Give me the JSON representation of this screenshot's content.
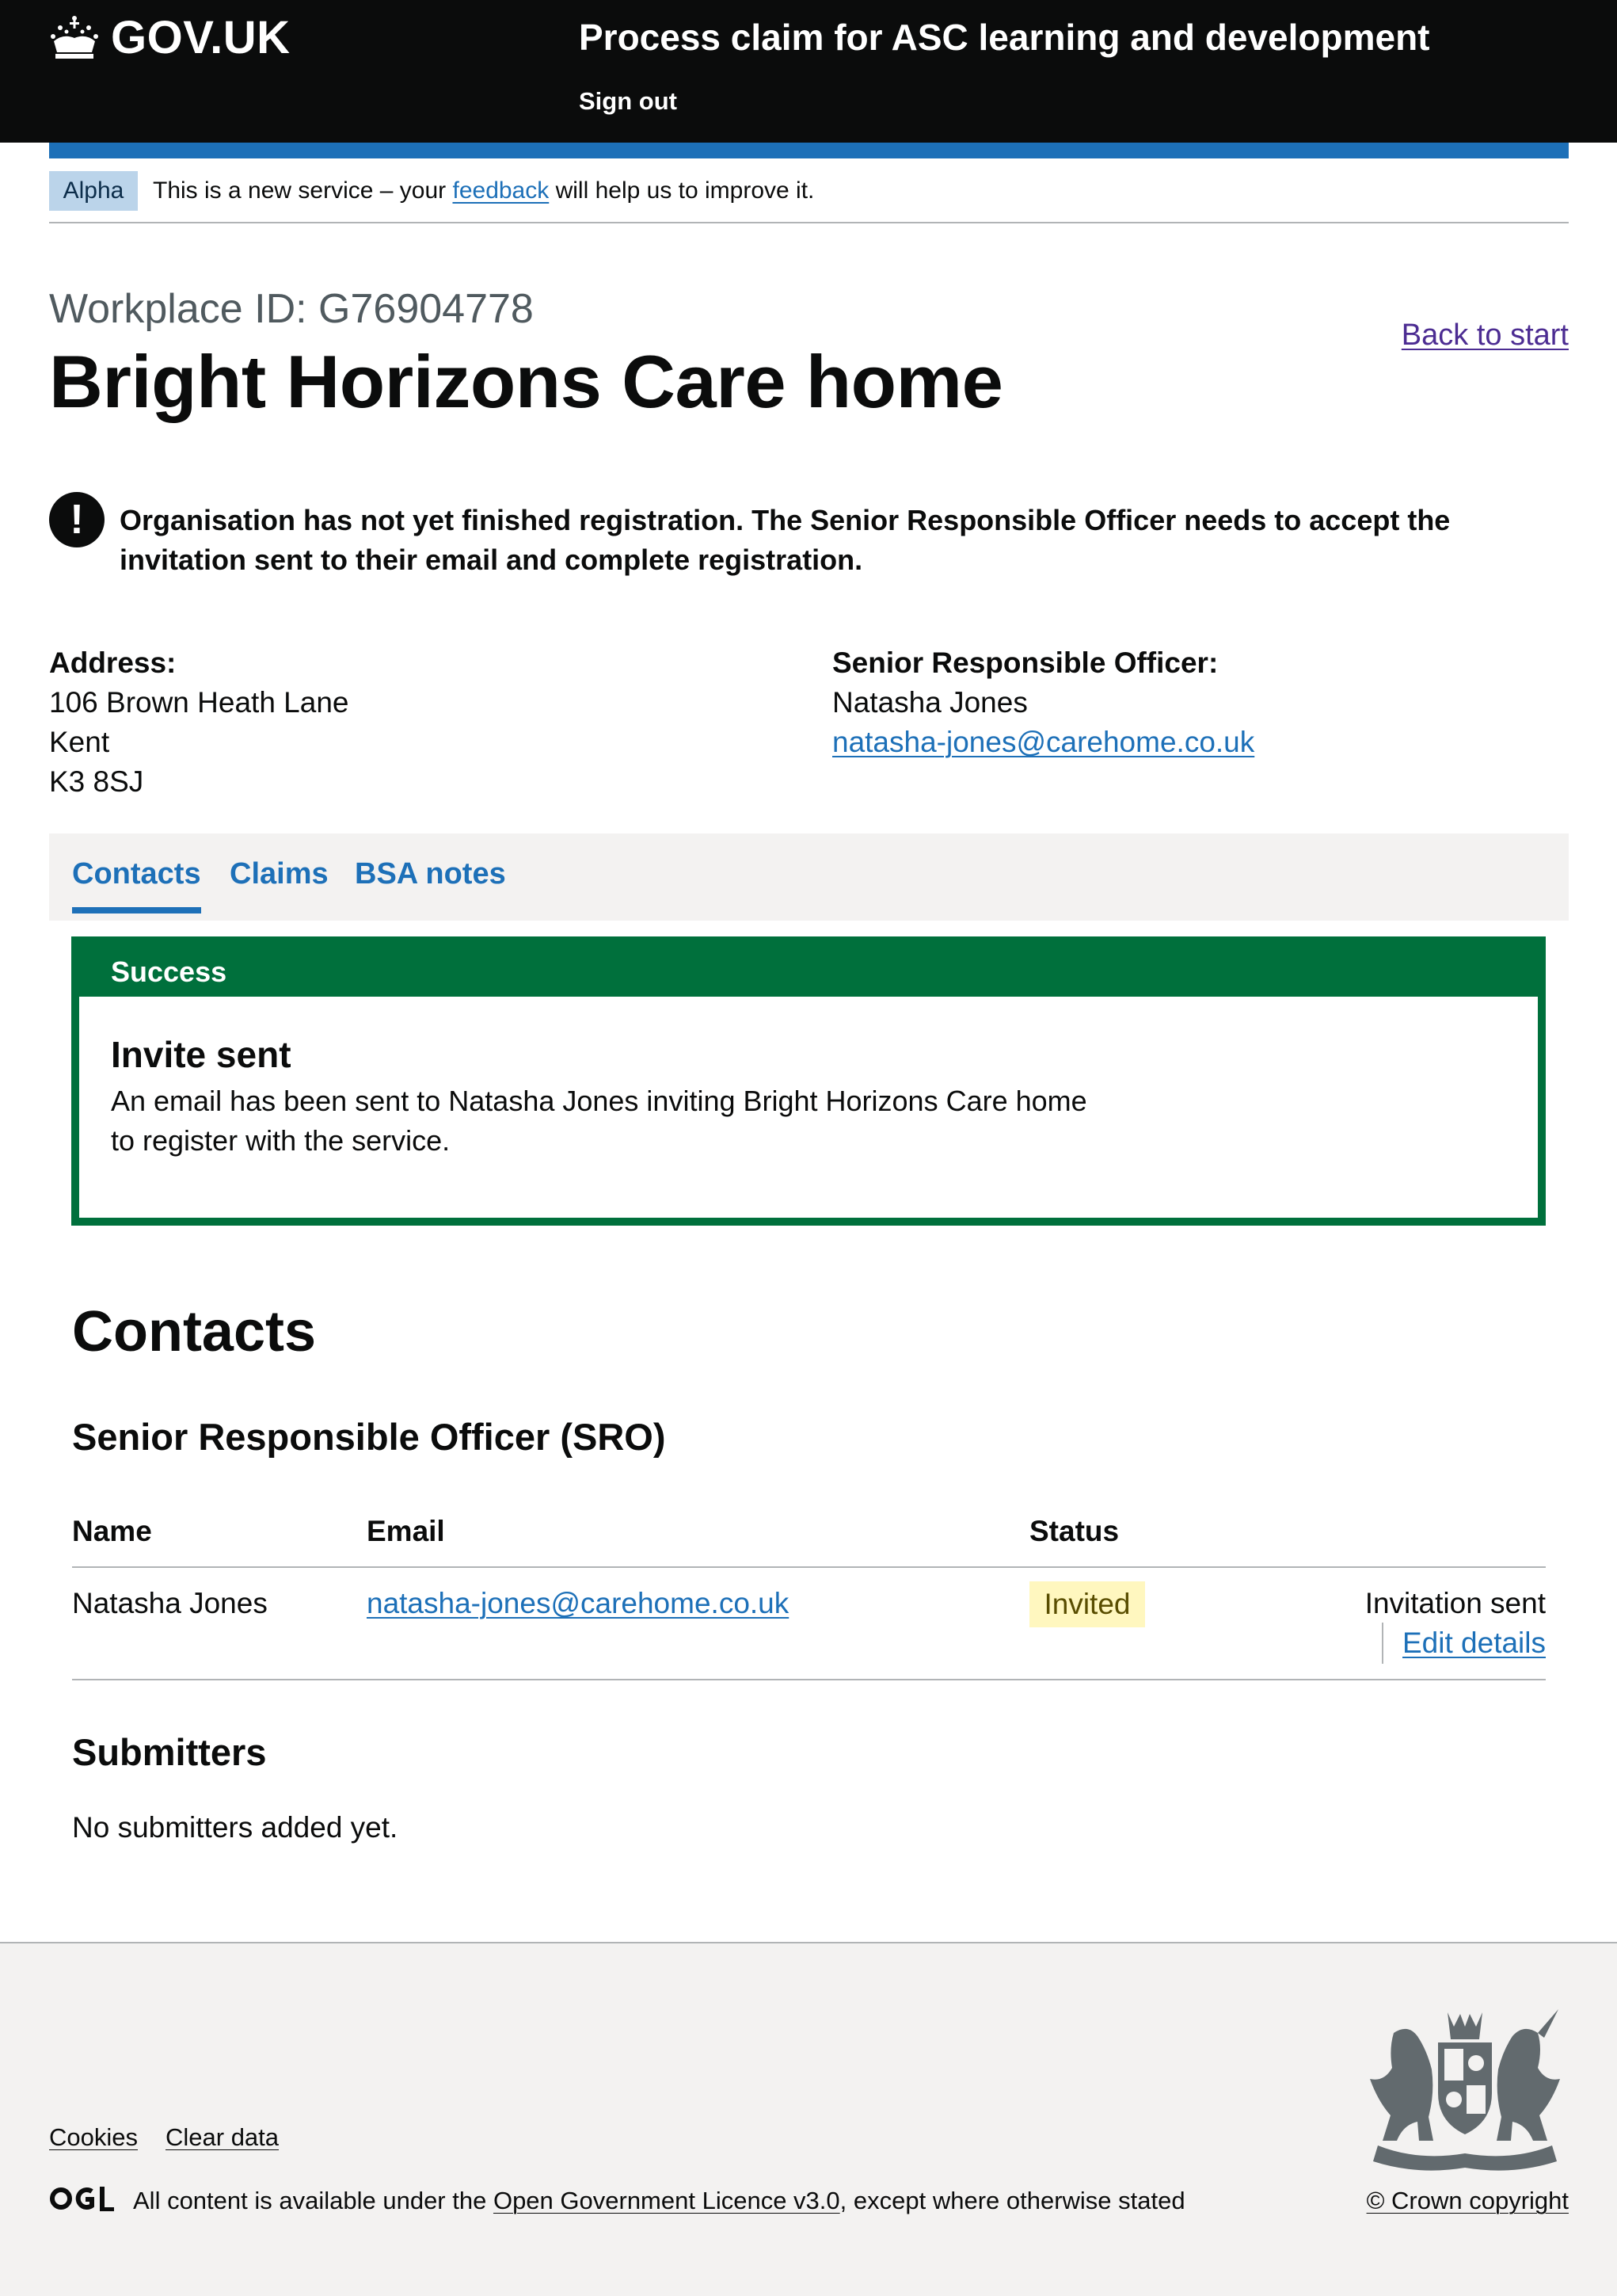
{
  "header": {
    "logo_text": "GOV.UK",
    "service_name": "Process claim for ASC learning and development",
    "sign_out": "Sign out"
  },
  "phase_banner": {
    "tag": "Alpha",
    "text_before": "This is a new service – your ",
    "link": "feedback",
    "text_after": " will help us to improve it."
  },
  "page": {
    "caption": "Workplace ID: G76904778",
    "title": "Bright Horizons Care home",
    "back_link": "Back to start"
  },
  "warning": {
    "icon": "!",
    "text": "Organisation has not yet finished registration. The Senior Responsible Officer needs to accept the invitation sent to their email and complete registration."
  },
  "address": {
    "label": "Address:",
    "line1": "106 Brown Heath Lane",
    "line2": "Kent",
    "line3": "K3 8SJ"
  },
  "sro_summary": {
    "label": "Senior Responsible Officer:",
    "name": "Natasha Jones",
    "email": "natasha-jones@carehome.co.uk"
  },
  "tabs": [
    {
      "label": "Contacts",
      "active": true
    },
    {
      "label": "Claims",
      "active": false
    },
    {
      "label": "BSA notes",
      "active": false
    }
  ],
  "success": {
    "heading": "Success",
    "title": "Invite sent",
    "body": "An email has been sent to Natasha Jones inviting Bright Horizons Care home to register with the service."
  },
  "contacts": {
    "heading": "Contacts",
    "sro_heading": "Senior Responsible Officer (SRO)",
    "columns": [
      "Name",
      "Email",
      "Status"
    ],
    "rows": [
      {
        "name": "Natasha Jones",
        "email": "natasha-jones@carehome.co.uk",
        "status": "Invited",
        "action_text": "Invitation sent",
        "action_link": "Edit details"
      }
    ],
    "submitters_heading": "Submitters",
    "submitters_empty": "No submitters added yet."
  },
  "footer": {
    "links": [
      "Cookies",
      "Clear data"
    ],
    "licence_before": "All content is available under the ",
    "licence_link": "Open Government Licence v3.0",
    "licence_after": ", except where otherwise stated",
    "copyright": "© Crown copyright"
  },
  "colors": {
    "header_bg": "#0b0c0c",
    "brand_blue": "#1d70b8",
    "success_green": "#00703c",
    "tag_yellow": "#fff7bf",
    "footer_bg": "#f3f2f1"
  }
}
